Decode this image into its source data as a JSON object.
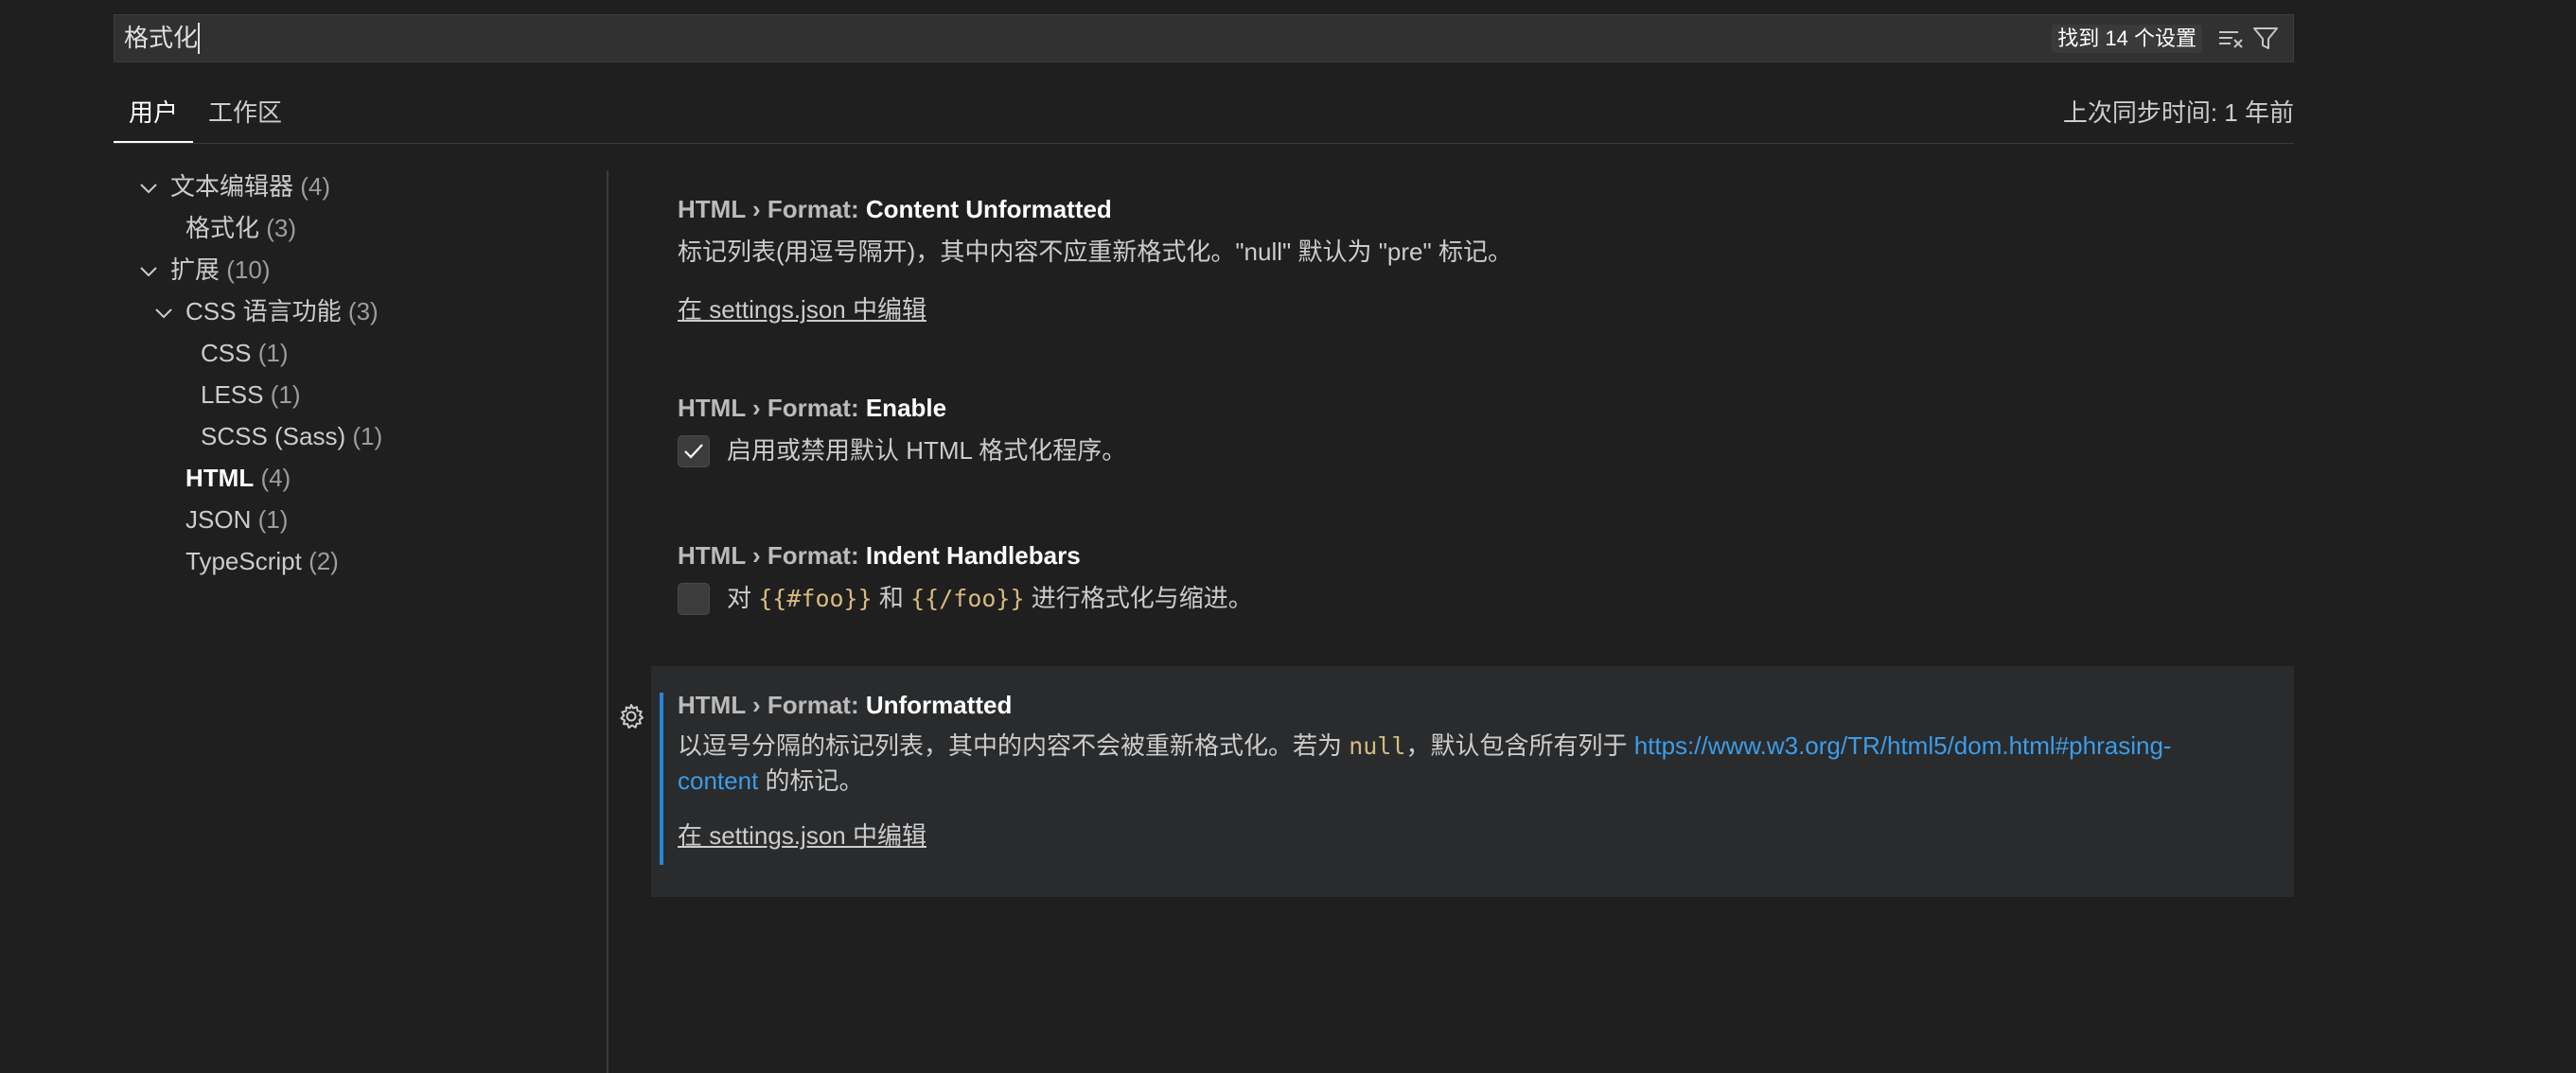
{
  "search": {
    "value": "格式化",
    "result_count": "找到 14 个设置"
  },
  "tabs": {
    "user": "用户",
    "workspace": "工作区"
  },
  "sync_status": "上次同步时间: 1 年前",
  "toc": [
    {
      "name": "文本编辑器",
      "count": "(4)"
    },
    {
      "name": "格式化",
      "count": "(3)"
    },
    {
      "name": "扩展",
      "count": "(10)"
    },
    {
      "name": "CSS 语言功能",
      "count": "(3)"
    },
    {
      "name": "CSS",
      "count": "(1)"
    },
    {
      "name": "LESS",
      "count": "(1)"
    },
    {
      "name": "SCSS (Sass)",
      "count": "(1)"
    },
    {
      "name": "HTML",
      "count": "(4)"
    },
    {
      "name": "JSON",
      "count": "(1)"
    },
    {
      "name": "TypeScript",
      "count": "(2)"
    }
  ],
  "settings": [
    {
      "category": "HTML › Format: ",
      "key": "Content Unformatted",
      "description": "标记列表(用逗号隔开)，其中内容不应重新格式化。\"null\" 默认为 \"pre\" 标记。",
      "edit_link": "在 settings.json 中编辑"
    },
    {
      "category": "HTML › Format: ",
      "key": "Enable",
      "checked": true,
      "description": "启用或禁用默认 HTML 格式化程序。"
    },
    {
      "category": "HTML › Format: ",
      "key": "Indent Handlebars",
      "checked": false,
      "desc_prefix": "对 ",
      "code1": "{{#foo}}",
      "desc_mid": " 和 ",
      "code2": "{{/foo}}",
      "desc_suffix": " 进行格式化与缩进。"
    },
    {
      "category": "HTML › Format: ",
      "key": "Unformatted",
      "desc_prefix": "以逗号分隔的标记列表，其中的内容不会被重新格式化。若为 ",
      "code": "null",
      "desc_mid": "，默认包含所有列于 ",
      "link_part1": "https://www.w3.org/TR/html5/dom.html#phrasing-",
      "link_part2": "content",
      "desc_suffix": " 的标记。",
      "edit_link": "在 settings.json 中编辑"
    }
  ]
}
